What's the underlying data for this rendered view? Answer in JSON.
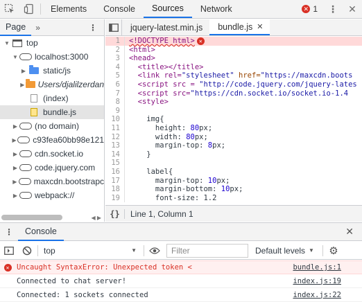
{
  "toolbar": {
    "tabs": [
      "Elements",
      "Console",
      "Sources",
      "Network"
    ],
    "active_tab": "Sources",
    "error_count": "1"
  },
  "navigator": {
    "tab_label": "Page",
    "items": [
      {
        "label": "top"
      },
      {
        "label": "localhost:3000"
      },
      {
        "label": "static/js"
      },
      {
        "label": "Users/djalilzerdan"
      },
      {
        "label": "(index)"
      },
      {
        "label": "bundle.js"
      },
      {
        "label": "(no domain)"
      },
      {
        "label": "c93fea60bb98e121"
      },
      {
        "label": "cdn.socket.io"
      },
      {
        "label": "code.jquery.com"
      },
      {
        "label": "maxcdn.bootstrapc"
      },
      {
        "label": "webpack://"
      }
    ]
  },
  "editor": {
    "tabs": [
      {
        "label": "jquery-latest.min.js"
      },
      {
        "label": "bundle.js"
      }
    ],
    "status": "Line 1, Column 1",
    "status_braces": "{}",
    "lines": {
      "n1": "1",
      "n2": "2",
      "n3": "3",
      "n4": "4",
      "n5": "5",
      "n6": "6",
      "n7": "7",
      "n8": "8",
      "n9": "9",
      "n10": "10",
      "n11": "11",
      "n12": "12",
      "n13": "13",
      "n14": "14",
      "n15": "15",
      "n16": "16",
      "n17": "17",
      "n18": "18",
      "n19": "19",
      "l1": "<!DOCTYPE html>",
      "l2": "<html>",
      "l3": "<head>",
      "l4": "  <title></title>",
      "l5_a": "  <link rel=",
      "l5_b": "\"stylesheet\"",
      "l5_c": " href=",
      "l5_d": "\"https://maxcdn.boots",
      "l6_a": "  <script src = ",
      "l6_b": "\"http://code.jquery.com/jquery-lates",
      "l7_a": "  <script src=",
      "l7_b": "\"https://cdn.socket.io/socket.io-1.4",
      "l8": "  <style>",
      "l9": "",
      "l10": "    img{",
      "l11_a": "      height: ",
      "l11_b": "80",
      "l11_c": "px;",
      "l12_a": "      width: ",
      "l12_b": "80",
      "l12_c": "px;",
      "l13_a": "      margin-top: ",
      "l13_b": "8",
      "l13_c": "px;",
      "l14": "    }",
      "l15": "",
      "l16": "    label{",
      "l17_a": "      margin-top: ",
      "l17_b": "10",
      "l17_c": "px;",
      "l18_a": "      margin-bottom: ",
      "l18_b": "10",
      "l18_c": "px;",
      "l19": "      font-size: 1.2"
    }
  },
  "console": {
    "drawer_title": "Console",
    "context": "top",
    "filter_placeholder": "Filter",
    "levels": "Default levels",
    "messages": [
      {
        "text": "Uncaught SyntaxError: Unexpected token <",
        "source": "bundle.js:1",
        "level": "error"
      },
      {
        "text": "Connected to chat server!",
        "source": "index.js:19",
        "level": "info"
      },
      {
        "text": "Connected: 1 sockets connected",
        "source": "index.js:22",
        "level": "info"
      }
    ]
  },
  "colors": {
    "accent": "#1a73e8",
    "error": "#d93025",
    "folder_blue": "#4d8ff0",
    "folder_orange": "#f29a36"
  }
}
